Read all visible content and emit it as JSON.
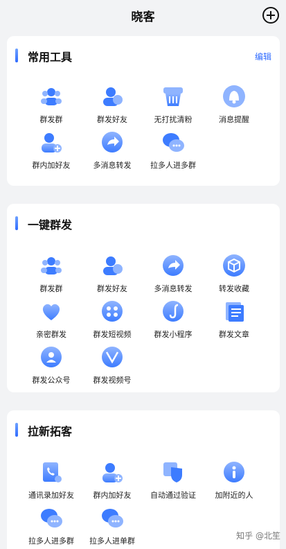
{
  "header": {
    "title": "晓客"
  },
  "sections": [
    {
      "title": "常用工具",
      "edit_label": "编辑",
      "items": [
        {
          "label": "群发群",
          "icon": "group-send-icon"
        },
        {
          "label": "群发好友",
          "icon": "friend-send-icon"
        },
        {
          "label": "无打扰清粉",
          "icon": "clean-fans-icon"
        },
        {
          "label": "消息提醒",
          "icon": "bell-icon"
        },
        {
          "label": "群内加好友",
          "icon": "add-friend-icon"
        },
        {
          "label": "多消息转发",
          "icon": "forward-icon"
        },
        {
          "label": "拉多人进多群",
          "icon": "chat-bubbles-icon"
        }
      ]
    },
    {
      "title": "一键群发",
      "items": [
        {
          "label": "群发群",
          "icon": "group-send-icon"
        },
        {
          "label": "群发好友",
          "icon": "friend-send-icon"
        },
        {
          "label": "多消息转发",
          "icon": "forward-icon"
        },
        {
          "label": "转发收藏",
          "icon": "cube-icon"
        },
        {
          "label": "亲密群发",
          "icon": "heart-icon"
        },
        {
          "label": "群发短视频",
          "icon": "video-icon"
        },
        {
          "label": "群发小程序",
          "icon": "miniprogram-icon"
        },
        {
          "label": "群发文章",
          "icon": "article-icon"
        },
        {
          "label": "群发公众号",
          "icon": "official-account-icon"
        },
        {
          "label": "群发视频号",
          "icon": "channels-icon"
        }
      ]
    },
    {
      "title": "拉新拓客",
      "items": [
        {
          "label": "通讯录加好友",
          "icon": "contacts-icon"
        },
        {
          "label": "群内加好友",
          "icon": "add-friend-icon"
        },
        {
          "label": "自动通过验证",
          "icon": "verify-icon"
        },
        {
          "label": "加附近的人",
          "icon": "location-icon"
        },
        {
          "label": "拉多人进多群",
          "icon": "chat-bubbles-icon"
        },
        {
          "label": "拉多人进单群",
          "icon": "chat-bubbles-icon"
        }
      ]
    }
  ],
  "watermark": "知乎 @北笙",
  "colors": {
    "accent": "#2f6bff",
    "icon_light": "#8fb4ff",
    "icon_dark": "#3d7cff"
  }
}
